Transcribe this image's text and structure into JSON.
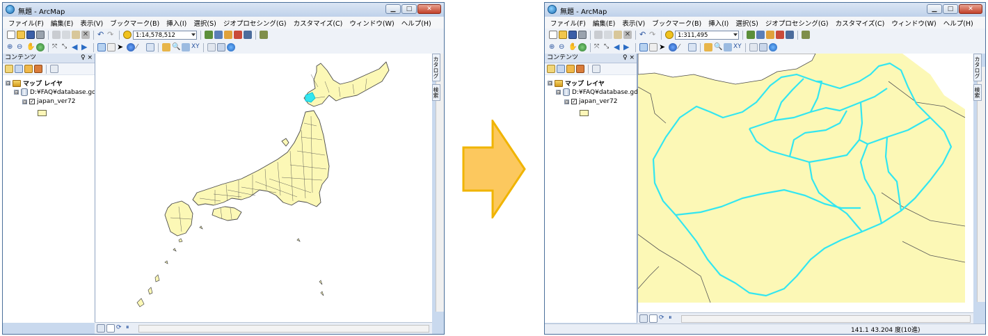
{
  "app_title": "無題 - ArcMap",
  "menu": [
    "ファイル(F)",
    "編集(E)",
    "表示(V)",
    "ブックマーク(B)",
    "挿入(I)",
    "選択(S)",
    "ジオプロセシング(G)",
    "カスタマイズ(C)",
    "ウィンドウ(W)",
    "ヘルプ(H)"
  ],
  "window_buttons": {
    "minimize": "▁",
    "maximize": "□",
    "close": "✕"
  },
  "toc": {
    "title": "コンテンツ",
    "pin": "♀ ×",
    "map_layers": "マップ レイヤ",
    "geodatabase": "D:¥FAQ¥database.gdb",
    "layer": "japan_ver72",
    "layer_checked": "✓",
    "expand": "⊟"
  },
  "side_tabs": [
    "カタログ",
    "検索"
  ],
  "before": {
    "scale": "1:14,578,512",
    "status": ""
  },
  "after": {
    "scale": "1:311,495",
    "status": "141.1  43.204 度(10進)"
  },
  "colors": {
    "land": "#fcf8b6",
    "boundary": "#4a4a4a",
    "selection": "#33e6f0",
    "arrow_fill": "#fcc85e",
    "arrow_stroke": "#f0b400"
  },
  "icons": [
    "new-document-icon",
    "open-icon",
    "save-icon",
    "print-icon",
    "cut-icon",
    "copy-icon",
    "paste-icon",
    "delete-icon",
    "undo-icon",
    "redo-icon",
    "add-data-icon",
    "zoom-in-icon",
    "zoom-out-icon",
    "pan-icon",
    "full-extent-icon",
    "back-icon",
    "forward-icon",
    "select-icon",
    "identify-icon",
    "find-icon",
    "measure-icon",
    "arrow-right-icon"
  ]
}
